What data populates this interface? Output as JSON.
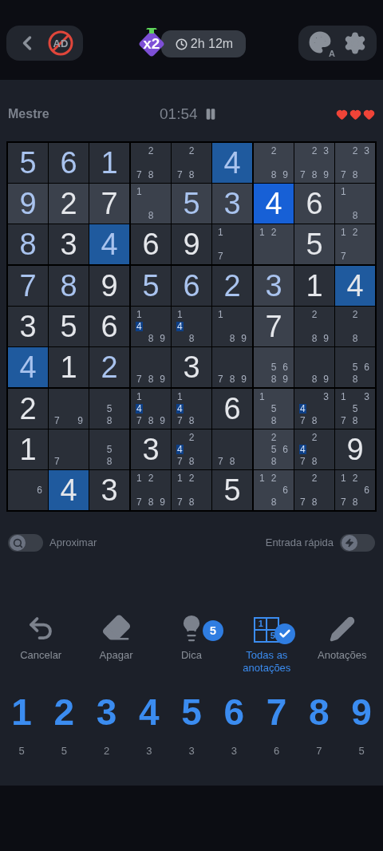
{
  "top_bar": {
    "ad_label": "AD",
    "multiplier": "x2",
    "session_time": "2h 12m",
    "theme_letter": "A"
  },
  "status": {
    "difficulty": "Mestre",
    "timer": "01:54",
    "hearts": [
      {
        "filled": true
      },
      {
        "filled": true
      },
      {
        "filled": true
      }
    ]
  },
  "grid": [
    [
      {
        "v": "5",
        "given": false,
        "selected": false,
        "same": false,
        "peer": false
      },
      {
        "v": "6",
        "given": false,
        "selected": false,
        "same": false,
        "peer": false
      },
      {
        "v": "1",
        "given": false,
        "selected": false,
        "same": false,
        "peer": false
      },
      {
        "notes": [
          "2",
          "7",
          "8"
        ],
        "selected": false,
        "same": false,
        "peer": false
      },
      {
        "notes": [
          "2",
          "7",
          "8"
        ],
        "selected": false,
        "same": false,
        "peer": false
      },
      {
        "v": "4",
        "given": false,
        "selected": false,
        "same": true
      },
      {
        "notes": [
          "2",
          "8",
          "9"
        ],
        "selected": false,
        "same": false,
        "peer": true
      },
      {
        "notes": [
          "2",
          "3",
          "7",
          "8",
          "9"
        ],
        "selected": false,
        "same": false,
        "peer": true
      },
      {
        "notes": [
          "2",
          "3",
          "7",
          "8"
        ],
        "selected": false,
        "same": false,
        "peer": true
      }
    ],
    [
      {
        "v": "9",
        "given": false,
        "selected": false,
        "same": false,
        "peer": true
      },
      {
        "v": "2",
        "given": true,
        "selected": false,
        "same": false,
        "peer": true
      },
      {
        "v": "7",
        "given": true,
        "selected": false,
        "same": false,
        "peer": true
      },
      {
        "notes": [
          "1",
          "8"
        ],
        "selected": false,
        "same": false,
        "peer": true
      },
      {
        "v": "5",
        "given": false,
        "selected": false,
        "same": false,
        "peer": true
      },
      {
        "v": "3",
        "given": false,
        "selected": false,
        "same": false,
        "peer": true
      },
      {
        "v": "4",
        "given": true,
        "selected": true
      },
      {
        "v": "6",
        "given": true,
        "selected": false,
        "same": false,
        "peer": true
      },
      {
        "notes": [
          "1",
          "8"
        ],
        "selected": false,
        "same": false,
        "peer": true
      }
    ],
    [
      {
        "v": "8",
        "given": false,
        "selected": false,
        "same": false,
        "peer": false
      },
      {
        "v": "3",
        "given": true,
        "selected": false,
        "same": false,
        "peer": false
      },
      {
        "v": "4",
        "given": false,
        "selected": false,
        "same": true
      },
      {
        "v": "6",
        "given": true,
        "selected": false,
        "same": false,
        "peer": false
      },
      {
        "v": "9",
        "given": true,
        "selected": false,
        "same": false,
        "peer": false
      },
      {
        "notes": [
          "1",
          "7"
        ],
        "selected": false,
        "same": false,
        "peer": false
      },
      {
        "notes": [
          "1",
          "2"
        ],
        "selected": false,
        "same": false,
        "peer": true
      },
      {
        "v": "5",
        "given": true,
        "selected": false,
        "same": false,
        "peer": true
      },
      {
        "notes": [
          "1",
          "2",
          "7"
        ],
        "selected": false,
        "same": false,
        "peer": true
      }
    ],
    [
      {
        "v": "7",
        "given": false,
        "selected": false,
        "same": false,
        "peer": false
      },
      {
        "v": "8",
        "given": false,
        "selected": false,
        "same": false,
        "peer": false
      },
      {
        "v": "9",
        "given": true,
        "selected": false,
        "same": false,
        "peer": false
      },
      {
        "v": "5",
        "given": false,
        "selected": false,
        "same": false,
        "peer": false
      },
      {
        "v": "6",
        "given": false,
        "selected": false,
        "same": false,
        "peer": false
      },
      {
        "v": "2",
        "given": false,
        "selected": false,
        "same": false,
        "peer": false
      },
      {
        "v": "3",
        "given": false,
        "selected": false,
        "same": false,
        "peer": true
      },
      {
        "v": "1",
        "given": true,
        "selected": false,
        "same": false,
        "peer": false
      },
      {
        "v": "4",
        "given": true,
        "selected": false,
        "same": true
      }
    ],
    [
      {
        "v": "3",
        "given": true,
        "selected": false,
        "same": false,
        "peer": false
      },
      {
        "v": "5",
        "given": true,
        "selected": false,
        "same": false,
        "peer": false
      },
      {
        "v": "6",
        "given": true,
        "selected": false,
        "same": false,
        "peer": false
      },
      {
        "notes": [
          {
            "d": "1",
            "hl": false
          },
          {
            "d": "4",
            "hl": true
          },
          {
            "d": "8",
            "hl": false
          },
          {
            "d": "9",
            "hl": false
          }
        ],
        "selected": false,
        "same": false,
        "peer": false
      },
      {
        "notes": [
          {
            "d": "1",
            "hl": false
          },
          {
            "d": "4",
            "hl": true
          },
          {
            "d": "8",
            "hl": false
          }
        ],
        "selected": false,
        "same": false,
        "peer": false
      },
      {
        "notes": [
          "1",
          "8",
          "9"
        ],
        "selected": false,
        "same": false,
        "peer": false
      },
      {
        "v": "7",
        "given": true,
        "selected": false,
        "same": false,
        "peer": true
      },
      {
        "notes": [
          "2",
          "8",
          "9"
        ],
        "selected": false,
        "same": false,
        "peer": false
      },
      {
        "notes": [
          "2",
          "8"
        ],
        "selected": false,
        "same": false,
        "peer": false
      }
    ],
    [
      {
        "v": "4",
        "given": false,
        "selected": false,
        "same": true
      },
      {
        "v": "1",
        "given": true,
        "selected": false,
        "same": false,
        "peer": false
      },
      {
        "v": "2",
        "given": false,
        "selected": false,
        "same": false,
        "peer": false
      },
      {
        "notes": [
          "7",
          "8",
          "9"
        ],
        "selected": false,
        "same": false,
        "peer": false
      },
      {
        "v": "3",
        "given": true,
        "selected": false,
        "same": false,
        "peer": false
      },
      {
        "notes": [
          "7",
          "8",
          "9"
        ],
        "selected": false,
        "same": false,
        "peer": false
      },
      {
        "notes": [
          "5",
          "6",
          "8",
          "9"
        ],
        "selected": false,
        "same": false,
        "peer": true
      },
      {
        "notes": [
          "8",
          "9"
        ],
        "selected": false,
        "same": false,
        "peer": false
      },
      {
        "notes": [
          "5",
          "6",
          "8"
        ],
        "selected": false,
        "same": false,
        "peer": false
      }
    ],
    [
      {
        "v": "2",
        "given": true,
        "selected": false,
        "same": false,
        "peer": false
      },
      {
        "notes": [
          "7",
          "9"
        ],
        "selected": false,
        "same": false,
        "peer": false
      },
      {
        "notes": [
          "5",
          "8"
        ],
        "selected": false,
        "same": false,
        "peer": false
      },
      {
        "notes": [
          {
            "d": "1",
            "hl": false
          },
          {
            "d": "4",
            "hl": true
          },
          {
            "d": "7",
            "hl": false
          },
          {
            "d": "8",
            "hl": false
          },
          {
            "d": "9",
            "hl": false
          }
        ],
        "selected": false,
        "same": false,
        "peer": false
      },
      {
        "notes": [
          {
            "d": "1",
            "hl": false
          },
          {
            "d": "4",
            "hl": true
          },
          {
            "d": "7",
            "hl": false
          },
          {
            "d": "8",
            "hl": false
          }
        ],
        "selected": false,
        "same": false,
        "peer": false
      },
      {
        "v": "6",
        "given": true,
        "selected": false,
        "same": false,
        "peer": false
      },
      {
        "notes": [
          "1",
          "5",
          "8"
        ],
        "selected": false,
        "same": false,
        "peer": true
      },
      {
        "notes": [
          {
            "d": "3",
            "hl": false
          },
          {
            "d": "4",
            "hl": true
          },
          {
            "d": "7",
            "hl": false
          },
          {
            "d": "8",
            "hl": false
          }
        ],
        "selected": false,
        "same": false,
        "peer": false
      },
      {
        "notes": [
          "1",
          "3",
          "5",
          "7",
          "8"
        ],
        "selected": false,
        "same": false,
        "peer": false
      }
    ],
    [
      {
        "v": "1",
        "given": true,
        "selected": false,
        "same": false,
        "peer": false
      },
      {
        "notes": [
          "7"
        ],
        "selected": false,
        "same": false,
        "peer": false
      },
      {
        "notes": [
          "5",
          "8"
        ],
        "selected": false,
        "same": false,
        "peer": false
      },
      {
        "v": "3",
        "given": true,
        "selected": false,
        "same": false,
        "peer": false
      },
      {
        "notes": [
          {
            "d": "2",
            "hl": false
          },
          {
            "d": "4",
            "hl": true
          },
          {
            "d": "7",
            "hl": false
          },
          {
            "d": "8",
            "hl": false
          }
        ],
        "selected": false,
        "same": false,
        "peer": false
      },
      {
        "notes": [
          "7",
          "8"
        ],
        "selected": false,
        "same": false,
        "peer": false
      },
      {
        "notes": [
          "2",
          "5",
          "6",
          "8"
        ],
        "selected": false,
        "same": false,
        "peer": true
      },
      {
        "notes": [
          {
            "d": "2",
            "hl": false
          },
          {
            "d": "4",
            "hl": true
          },
          {
            "d": "7",
            "hl": false
          },
          {
            "d": "8",
            "hl": false
          }
        ],
        "selected": false,
        "same": false,
        "peer": false
      },
      {
        "v": "9",
        "given": true,
        "selected": false,
        "same": false,
        "peer": false
      }
    ],
    [
      {
        "notes": [
          "6"
        ],
        "selected": false,
        "same": false,
        "peer": false
      },
      {
        "v": "4",
        "given": true,
        "selected": false,
        "same": true
      },
      {
        "v": "3",
        "given": true,
        "selected": false,
        "same": false,
        "peer": false
      },
      {
        "notes": [
          "1",
          "2",
          "7",
          "8",
          "9"
        ],
        "selected": false,
        "same": false,
        "peer": false
      },
      {
        "notes": [
          "1",
          "2",
          "7",
          "8"
        ],
        "selected": false,
        "same": false,
        "peer": false
      },
      {
        "v": "5",
        "given": true,
        "selected": false,
        "same": false,
        "peer": false
      },
      {
        "notes": [
          "1",
          "2",
          "6",
          "8"
        ],
        "selected": false,
        "same": false,
        "peer": true
      },
      {
        "notes": [
          "2",
          "7",
          "8"
        ],
        "selected": false,
        "same": false,
        "peer": false
      },
      {
        "notes": [
          "1",
          "2",
          "6",
          "7",
          "8"
        ],
        "selected": false,
        "same": false,
        "peer": false
      }
    ]
  ],
  "toggles": [
    {
      "kind": "zoom",
      "label": "Aproximar",
      "on": false
    },
    {
      "kind": "quick_entry",
      "label": "Entrada rápida",
      "on": false
    }
  ],
  "tools": [
    {
      "kind": "undo",
      "label": "Cancelar",
      "selected": false
    },
    {
      "kind": "erase",
      "label": "Apagar",
      "selected": false
    },
    {
      "kind": "hint",
      "label": "Dica",
      "badge": "5",
      "selected": false
    },
    {
      "kind": "all_notes",
      "label": "Todas as anotações",
      "icon_digits": [
        "1",
        "5"
      ],
      "selected": true
    },
    {
      "kind": "notes",
      "label": "Anotações",
      "selected": false
    }
  ],
  "number_pad": [
    {
      "digit": "1",
      "remaining": "5"
    },
    {
      "digit": "2",
      "remaining": "5"
    },
    {
      "digit": "3",
      "remaining": "2"
    },
    {
      "digit": "4",
      "remaining": "3"
    },
    {
      "digit": "5",
      "remaining": "3"
    },
    {
      "digit": "6",
      "remaining": "3"
    },
    {
      "digit": "7",
      "remaining": "6"
    },
    {
      "digit": "8",
      "remaining": "7"
    },
    {
      "digit": "9",
      "remaining": "5"
    }
  ]
}
